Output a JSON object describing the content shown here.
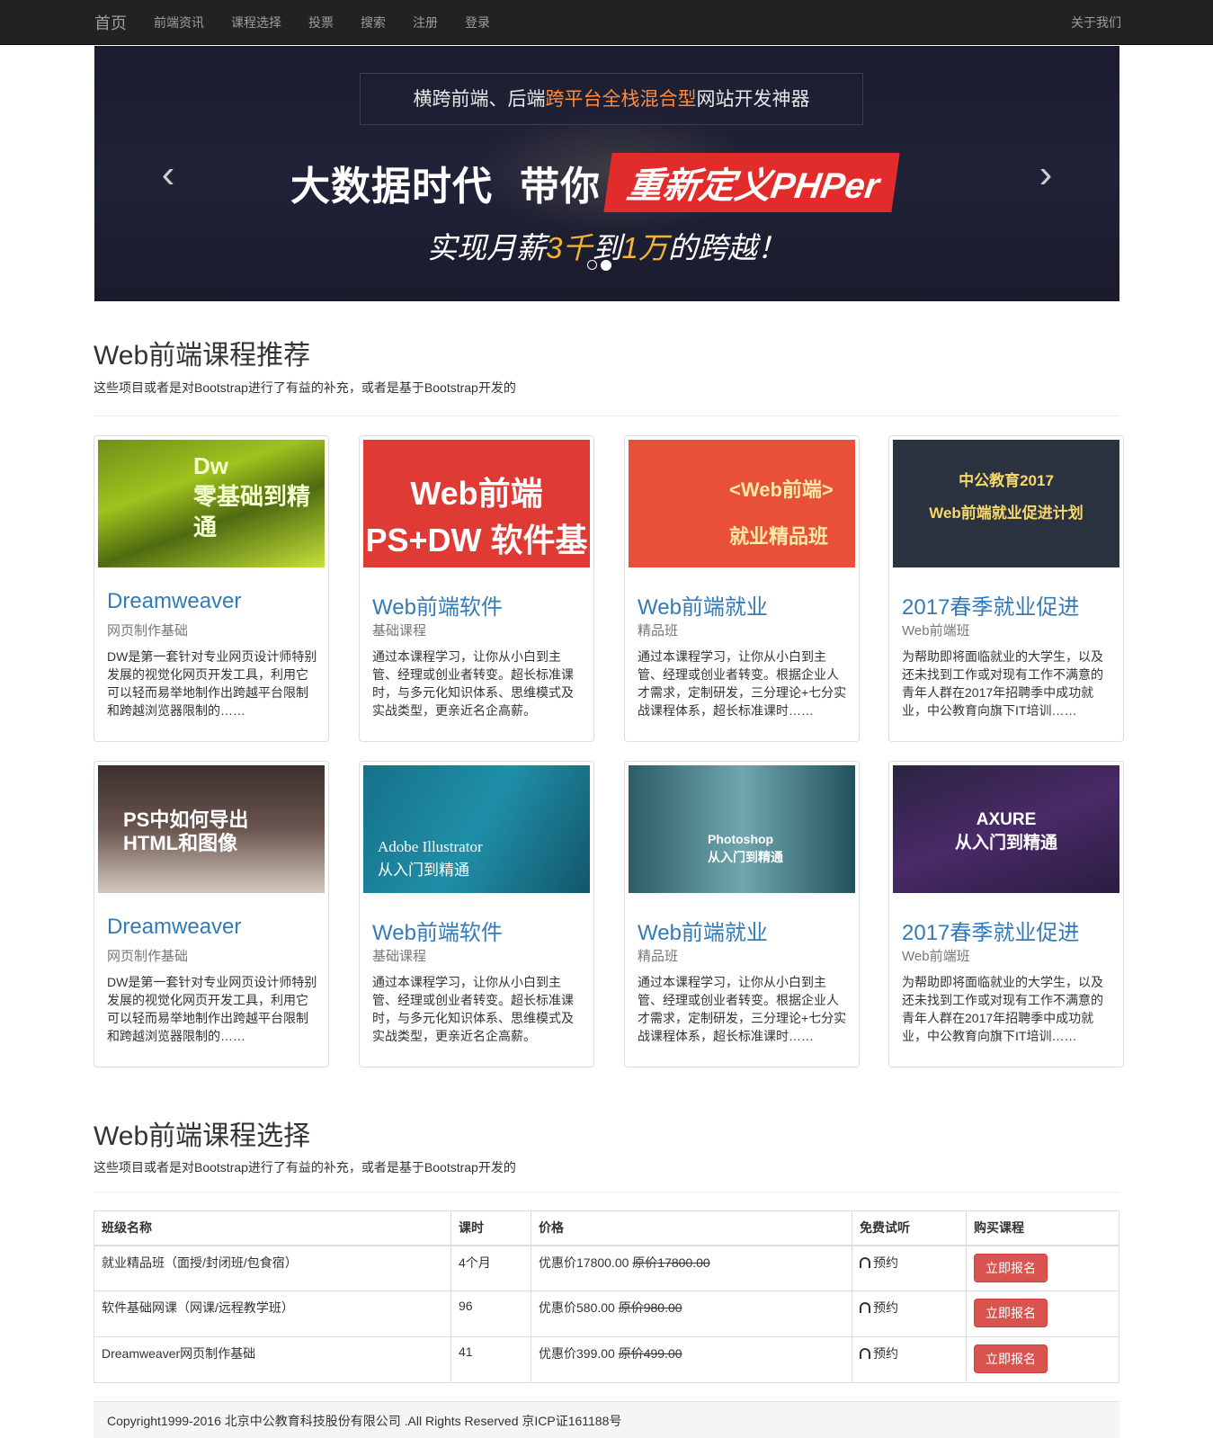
{
  "nav": {
    "brand": "首页",
    "links": [
      "前端资讯",
      "课程选择",
      "投票",
      "搜索",
      "注册",
      "登录"
    ],
    "right": "关于我们"
  },
  "carousel": {
    "tagline_pre": "横跨前端、后端",
    "tagline_hl": "跨平台全栈混合型",
    "tagline_post": "网站开发神器",
    "headline_1": "大数据时代",
    "headline_2": "带你",
    "headline_box": "重新定义PHPer",
    "sub_pre": "实现月薪",
    "sub_a": "3千",
    "sub_mid": "到",
    "sub_b": "1万",
    "sub_post": "的跨越！",
    "prev_icon": "chevron-left-icon",
    "next_icon": "chevron-right-icon",
    "active_slide": 2
  },
  "section1": {
    "title": "Web前端课程推荐",
    "desc": "这些项目或者是对Bootstrap进行了有益的补充，或者是基于Bootstrap开发的"
  },
  "cards": [
    {
      "art": "Dw\n零基础到精通",
      "title": "Dreamweaver",
      "sub": "网页制作基础",
      "text": "DW是第一套针对专业网页设计师特别发展的视觉化网页开发工具，利用它可以轻而易举地制作出跨越平台限制和跨越浏览器限制的……"
    },
    {
      "art": "Web前端\nPS+DW 软件基础",
      "title": "Web前端软件",
      "sub": "基础课程",
      "text": "通过本课程学习，让你从小白到主管、经理或创业者转变。超长标准课时，与多元化知识体系、思维模式及实战类型，更亲近名企高薪。"
    },
    {
      "art": "<Web前端>\n就业精品班",
      "title": "Web前端就业",
      "sub": "精品班",
      "text": "通过本课程学习，让你从小白到主管、经理或创业者转变。根据企业人才需求，定制研发，三分理论+七分实战课程体系，超长标准课时……"
    },
    {
      "art": "中公教育2017\nWeb前端就业促进计划",
      "title": "2017春季就业促进",
      "sub": "Web前端班",
      "text": "为帮助即将面临就业的大学生，以及还未找到工作或对现有工作不满意的青年人群在2017年招聘季中成功就业，中公教育向旗下IT培训……"
    },
    {
      "art": "PS中如何导出\nHTML和图像",
      "title": "Dreamweaver",
      "sub": "网页制作基础",
      "text": "DW是第一套针对专业网页设计师特别发展的视觉化网页开发工具，利用它可以轻而易举地制作出跨越平台限制和跨越浏览器限制的……"
    },
    {
      "art": "Adobe Illustrator\n从入门到精通",
      "title": "Web前端软件",
      "sub": "基础课程",
      "text": "通过本课程学习，让你从小白到主管、经理或创业者转变。超长标准课时，与多元化知识体系、思维模式及实战类型，更亲近名企高薪。"
    },
    {
      "art": "Photoshop\n从入门到精通",
      "title": "Web前端就业",
      "sub": "精品班",
      "text": "通过本课程学习，让你从小白到主管、经理或创业者转变。根据企业人才需求，定制研发，三分理论+七分实战课程体系，超长标准课时……"
    },
    {
      "art": "AXURE\n从入门到精通",
      "title": "2017春季就业促进",
      "sub": "Web前端班",
      "text": "为帮助即将面临就业的大学生，以及还未找到工作或对现有工作不满意的青年人群在2017年招聘季中成功就业，中公教育向旗下IT培训……"
    }
  ],
  "section2": {
    "title": "Web前端课程选择",
    "desc": "这些项目或者是对Bootstrap进行了有益的补充，或者是基于Bootstrap开发的"
  },
  "table": {
    "headers": [
      "班级名称",
      "课时",
      "价格",
      "免费试听",
      "购买课程"
    ],
    "rows": [
      {
        "name": "就业精品班（面授/封闭班/包食宿）",
        "hours": "4个月",
        "price_sale": "优惠价17800.00",
        "price_orig_label": "原价",
        "price_orig": "17800.00",
        "trial": "预约",
        "buy": "立即报名"
      },
      {
        "name": "软件基础网课（网课/远程教学班）",
        "hours": "96",
        "price_sale": "优惠价580.00",
        "price_orig_label": "原价",
        "price_orig": "980.00",
        "trial": "预约",
        "buy": "立即报名"
      },
      {
        "name": "Dreamweaver网页制作基础",
        "hours": "41",
        "price_sale": "优惠价399.00",
        "price_orig_label": "原价",
        "price_orig": "499.00",
        "trial": "预约",
        "buy": "立即报名"
      }
    ],
    "trial_icon": "headphones-icon"
  },
  "footer": {
    "text": "Copyright1999-2016 北京中公教育科技股份有限公司 .All Rights Reserved 京ICP证161188号"
  },
  "colors": {
    "navbar": "#222222",
    "link": "#337ab7",
    "danger": "#d9534f",
    "carousel_bg": "#1e2034",
    "highlight_orange": "#ff8a3d",
    "headline_red": "#e22c2c"
  }
}
